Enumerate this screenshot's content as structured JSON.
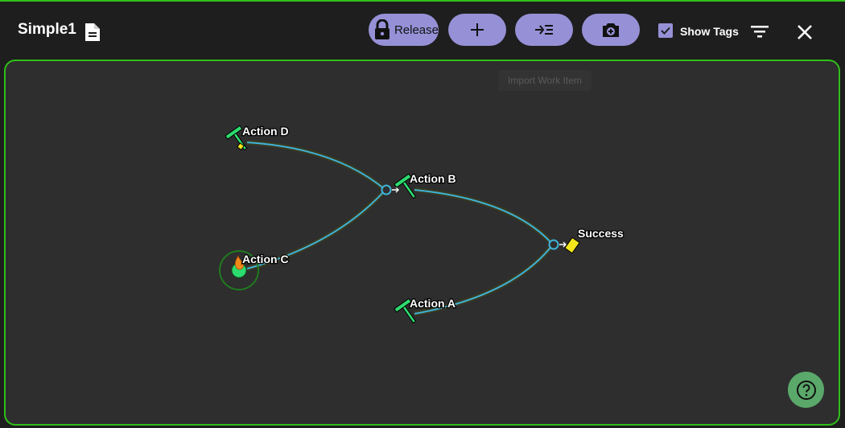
{
  "header": {
    "title": "Simple1",
    "release_label": "Release",
    "show_tags_label": "Show Tags",
    "show_tags_checked": true
  },
  "canvas": {
    "tooltip": "Import Work Item",
    "nodes": {
      "action_d": "Action D",
      "action_b": "Action B",
      "action_c": "Action C",
      "action_a": "Action A",
      "success": "Success"
    }
  },
  "colors": {
    "accent": "#9691d6",
    "border": "#2fbf19",
    "edge": "#3fb3d6",
    "node_green": "#2ddc6f",
    "success_flag": "#f5e61b",
    "help_button": "#5aa96a"
  },
  "icons": [
    "document-icon",
    "lock-icon",
    "plus-icon",
    "import-icon",
    "camera-icon",
    "checkbox-icon",
    "filter-icon",
    "close-icon",
    "hammer-icon",
    "flag-icon",
    "fire-icon",
    "help-icon"
  ]
}
